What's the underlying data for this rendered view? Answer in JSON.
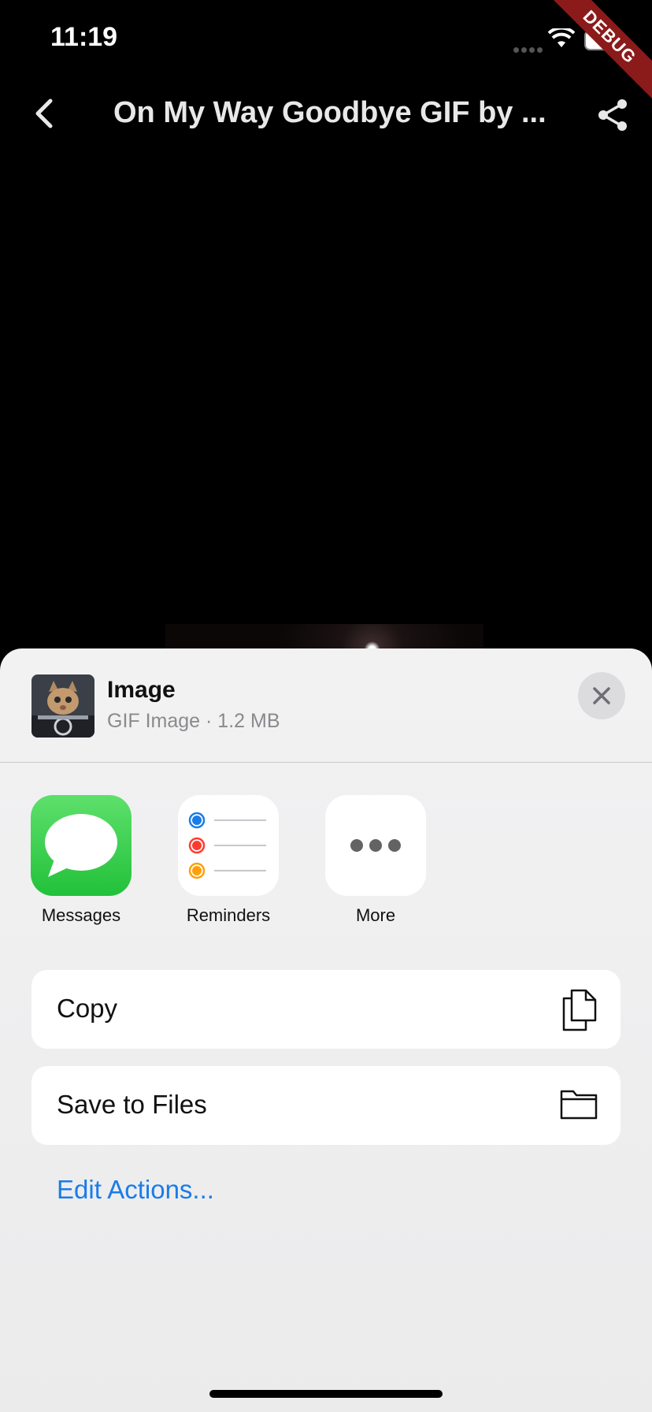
{
  "status_bar": {
    "time": "11:19",
    "debug_label": "DEBUG"
  },
  "app_bar": {
    "title": "On My Way Goodbye GIF by ..."
  },
  "share_sheet": {
    "item_title": "Image",
    "item_meta": "GIF Image · 1.2 MB",
    "apps": [
      {
        "label": "Messages",
        "icon": "messages-icon"
      },
      {
        "label": "Reminders",
        "icon": "reminders-icon"
      },
      {
        "label": "More",
        "icon": "more-icon"
      }
    ],
    "actions": [
      {
        "label": "Copy",
        "icon": "copy-icon"
      },
      {
        "label": "Save to Files",
        "icon": "folder-icon"
      }
    ],
    "edit_actions_label": "Edit Actions..."
  },
  "colors": {
    "accent": "#1a7ce8",
    "debug_ribbon": "#8b1a1a",
    "messages_green": "#30d158"
  }
}
